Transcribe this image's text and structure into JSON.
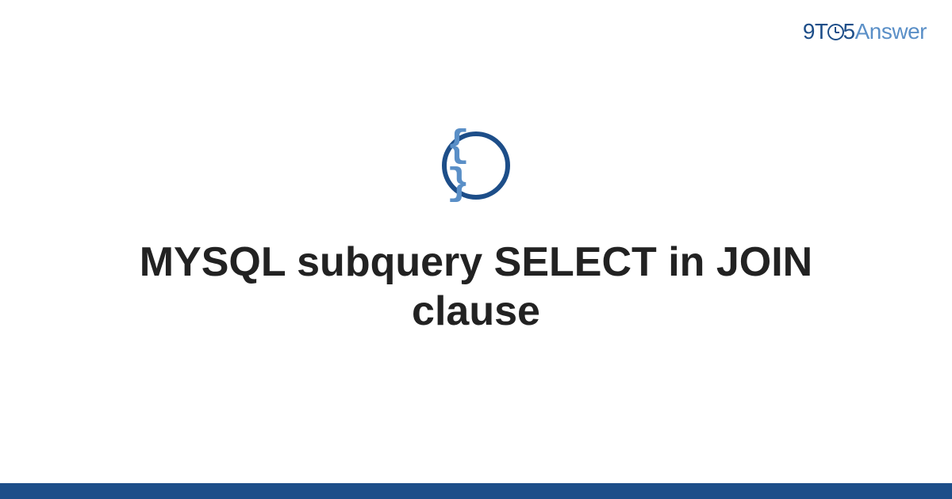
{
  "logo": {
    "part1": "9T",
    "part2": "5",
    "part3": "Answer"
  },
  "icon": {
    "braces": "{ }",
    "name": "code-braces-icon"
  },
  "title": "MYSQL subquery SELECT in JOIN clause",
  "colors": {
    "brand_dark": "#1d4e89",
    "brand_light": "#5a8fc7",
    "text": "#222222"
  }
}
